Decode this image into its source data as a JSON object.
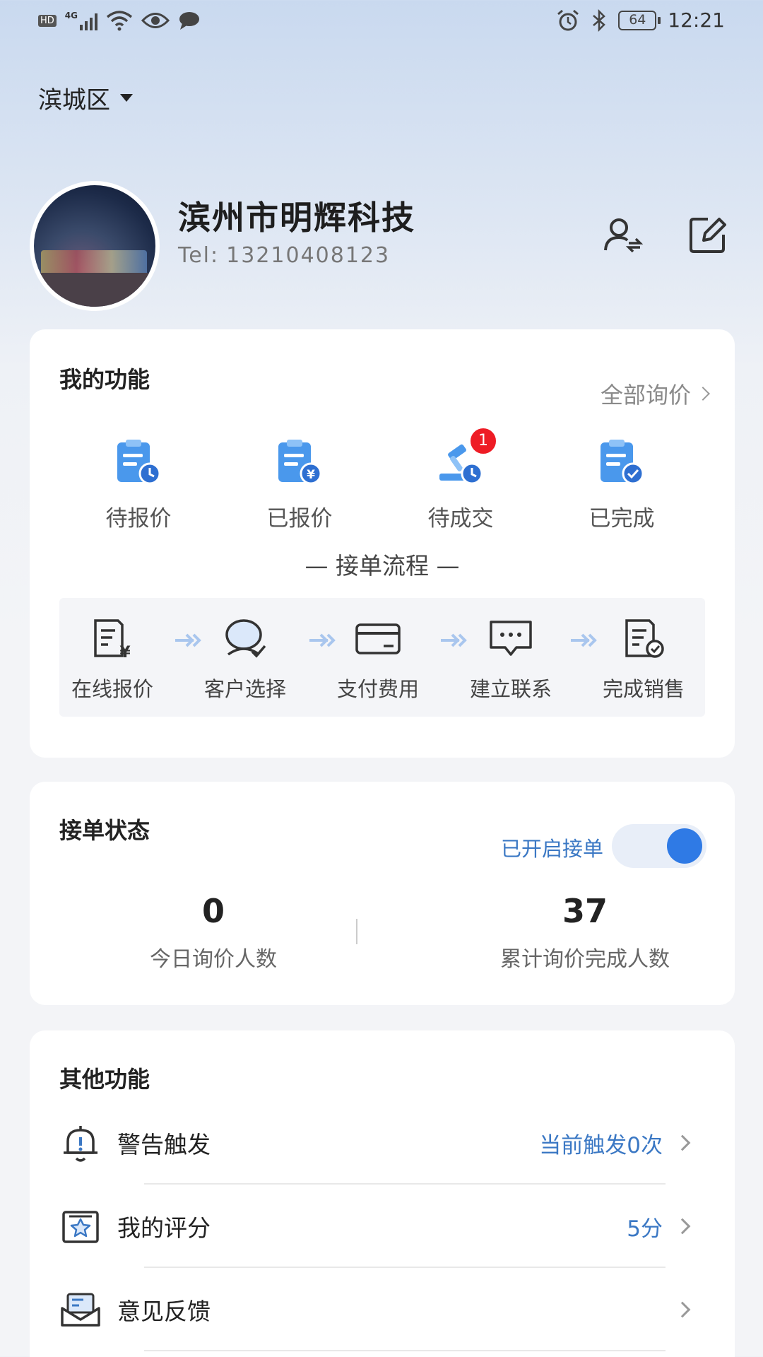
{
  "status_bar": {
    "left_icons": [
      "hd-icon",
      "signal-4g-icon",
      "wifi-icon",
      "eye-icon",
      "message-icon"
    ],
    "network_label": "HD",
    "network_type": "4G",
    "battery": "64",
    "time": "12:21",
    "right_icons": [
      "alarm-icon",
      "bluetooth-icon",
      "battery-icon"
    ]
  },
  "location": {
    "label": "滨城区"
  },
  "profile": {
    "company": "滨州市明辉科技",
    "tel_label": "Tel:",
    "tel_number": "13210408123",
    "actions": [
      "switch-user-icon",
      "edit-icon"
    ]
  },
  "functions": {
    "title": "我的功能",
    "all_inquiry": "全部询价",
    "items": [
      {
        "label": "待报价",
        "icon": "clipboard-clock-icon"
      },
      {
        "label": "已报价",
        "icon": "clipboard-yen-icon"
      },
      {
        "label": "待成交",
        "icon": "gavel-clock-icon",
        "badge": "1"
      },
      {
        "label": "已完成",
        "icon": "clipboard-check-icon"
      }
    ],
    "flow_title": "— 接单流程 —",
    "flow_steps": [
      {
        "label": "在线报价",
        "icon": "quote-document-icon"
      },
      {
        "label": "客户选择",
        "icon": "customer-select-icon"
      },
      {
        "label": "支付费用",
        "icon": "card-icon"
      },
      {
        "label": "建立联系",
        "icon": "chat-bubble-icon"
      },
      {
        "label": "完成销售",
        "icon": "document-check-icon"
      }
    ]
  },
  "order_status": {
    "title": "接单状态",
    "toggle_label": "已开启接单",
    "toggle_on": true,
    "today_count": "0",
    "today_label": "今日询价人数",
    "total_count": "37",
    "total_label": "累计询价完成人数"
  },
  "other": {
    "title": "其他功能",
    "rows": [
      {
        "label": "警告触发",
        "value": "当前触发0次",
        "icon": "alarm-bell-icon"
      },
      {
        "label": "我的评分",
        "value": "5分",
        "icon": "rating-star-icon"
      },
      {
        "label": "意见反馈",
        "value": "",
        "icon": "feedback-mail-icon"
      }
    ]
  },
  "colors": {
    "accent": "#2f7ae5",
    "link_blue": "#3b78c4",
    "badge_red": "#ee1c25"
  }
}
